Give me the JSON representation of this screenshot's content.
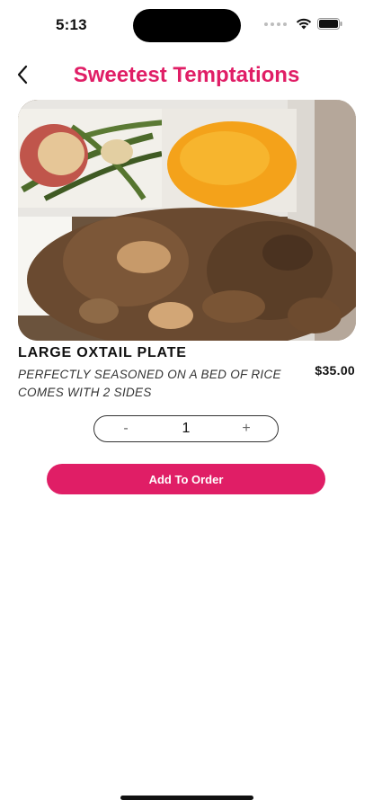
{
  "status_bar": {
    "time": "5:13",
    "wifi_icon": "wifi-icon",
    "battery_icon": "battery-icon"
  },
  "header": {
    "back_icon": "chevron-left-icon",
    "title": "Sweetest Temptations"
  },
  "item": {
    "image_icon": "food-photo",
    "name": "LARGE OXTAIL PLATE",
    "description": "PERFECTLY SEASONED ON A BED OF RICE COMES WITH 2 SIDES",
    "price": "$35.00"
  },
  "quantity": {
    "minus_label": "-",
    "value": "1",
    "plus_label": "+"
  },
  "actions": {
    "add_label": "Add To Order"
  },
  "colors": {
    "accent": "#E01E66"
  }
}
